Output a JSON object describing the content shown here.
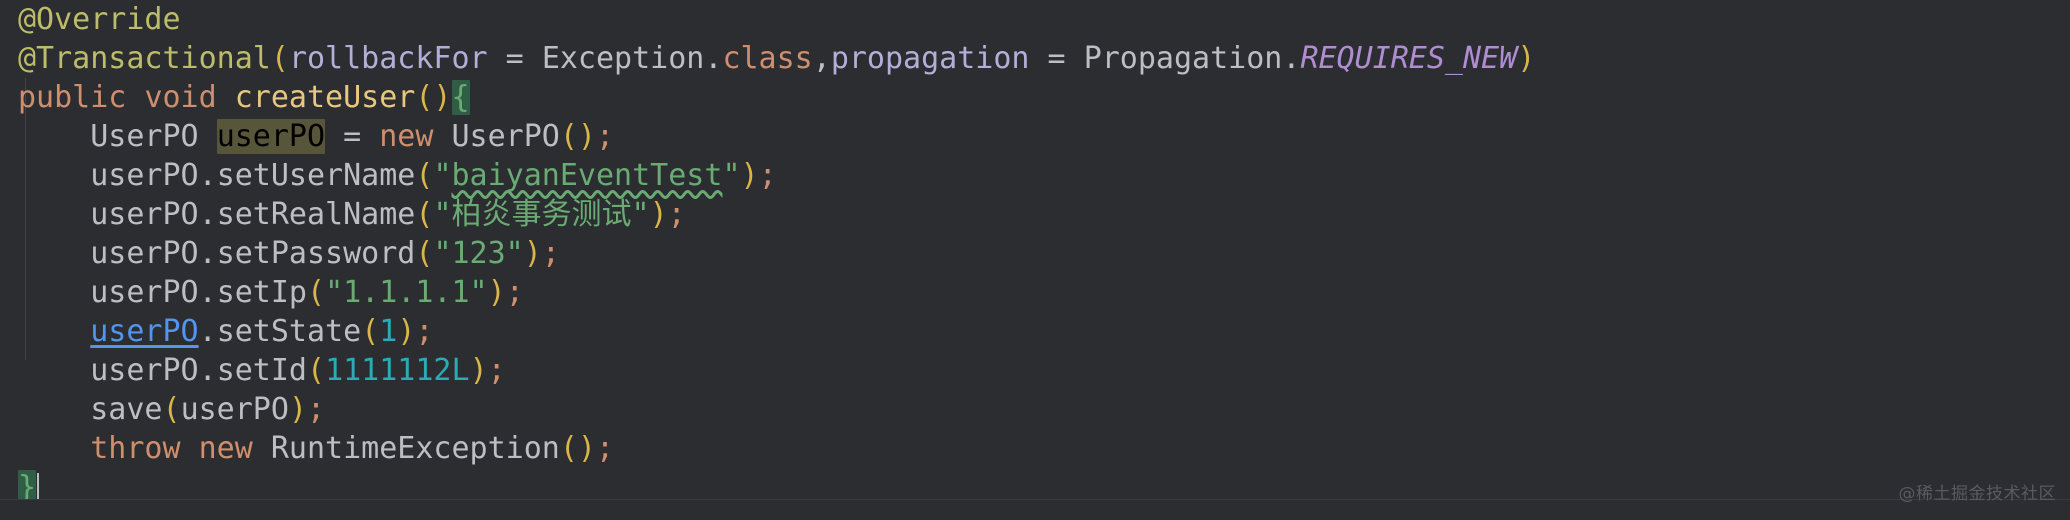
{
  "editor": {
    "language": "java",
    "background_color": "#2b2d30",
    "watermark": "@稀土掘金技术社区",
    "lines": [
      {
        "index": 1,
        "text": "@Override",
        "tokens": [
          {
            "t": "@Override",
            "c": "annotation"
          }
        ]
      },
      {
        "index": 2,
        "text": "@Transactional(rollbackFor = Exception.class,propagation = Propagation.REQUIRES_NEW)",
        "tokens": [
          {
            "t": "@Transactional",
            "c": "annotation"
          },
          {
            "t": "(",
            "c": "paren"
          },
          {
            "t": "rollbackFor",
            "c": "named-arg"
          },
          {
            "t": " = ",
            "c": "punct"
          },
          {
            "t": "Exception",
            "c": "classref"
          },
          {
            "t": ".",
            "c": "dot"
          },
          {
            "t": "class",
            "c": "keyword"
          },
          {
            "t": ",",
            "c": "punct"
          },
          {
            "t": "propagation",
            "c": "named-arg"
          },
          {
            "t": " = ",
            "c": "punct"
          },
          {
            "t": "Propagation",
            "c": "classref"
          },
          {
            "t": ".",
            "c": "dot"
          },
          {
            "t": "REQUIRES_NEW",
            "c": "static-field"
          },
          {
            "t": ")",
            "c": "paren"
          }
        ]
      },
      {
        "index": 3,
        "text": "public void createUser(){",
        "tokens": [
          {
            "t": "public",
            "c": "keyword"
          },
          {
            "t": " ",
            "c": "punct"
          },
          {
            "t": "void",
            "c": "keyword"
          },
          {
            "t": " ",
            "c": "punct"
          },
          {
            "t": "createUser",
            "c": "method-decl"
          },
          {
            "t": "()",
            "c": "paren"
          },
          {
            "t": "{",
            "c": "hl-brace"
          }
        ]
      },
      {
        "index": 4,
        "text": "    UserPO userPO = new UserPO();",
        "tokens": [
          {
            "t": "    ",
            "c": "punct"
          },
          {
            "t": "UserPO",
            "c": "classref"
          },
          {
            "t": " ",
            "c": "punct"
          },
          {
            "t": "userPO",
            "c": "hl-ident"
          },
          {
            "t": " = ",
            "c": "punct"
          },
          {
            "t": "new",
            "c": "keyword"
          },
          {
            "t": " ",
            "c": "punct"
          },
          {
            "t": "UserPO",
            "c": "classref"
          },
          {
            "t": "()",
            "c": "paren"
          },
          {
            "t": ";",
            "c": "semi"
          }
        ]
      },
      {
        "index": 5,
        "text": "    userPO.setUserName(\"baiyanEventTest\");",
        "tokens": [
          {
            "t": "    ",
            "c": "punct"
          },
          {
            "t": "userPO",
            "c": "ident"
          },
          {
            "t": ".",
            "c": "dot"
          },
          {
            "t": "setUserName",
            "c": "ident"
          },
          {
            "t": "(",
            "c": "paren"
          },
          {
            "t": "\"",
            "c": "string"
          },
          {
            "t": "baiyanEventTest",
            "c": "string squiggle"
          },
          {
            "t": "\"",
            "c": "string"
          },
          {
            "t": ")",
            "c": "paren"
          },
          {
            "t": ";",
            "c": "semi"
          }
        ]
      },
      {
        "index": 6,
        "text": "    userPO.setRealName(\"柏炎事务测试\");",
        "tokens": [
          {
            "t": "    ",
            "c": "punct"
          },
          {
            "t": "userPO",
            "c": "ident"
          },
          {
            "t": ".",
            "c": "dot"
          },
          {
            "t": "setRealName",
            "c": "ident"
          },
          {
            "t": "(",
            "c": "paren"
          },
          {
            "t": "\"",
            "c": "string"
          },
          {
            "t": "柏炎事务测试",
            "c": "string cn"
          },
          {
            "t": "\"",
            "c": "string"
          },
          {
            "t": ")",
            "c": "paren"
          },
          {
            "t": ";",
            "c": "semi"
          }
        ]
      },
      {
        "index": 7,
        "text": "    userPO.setPassword(\"123\");",
        "tokens": [
          {
            "t": "    ",
            "c": "punct"
          },
          {
            "t": "userPO",
            "c": "ident"
          },
          {
            "t": ".",
            "c": "dot"
          },
          {
            "t": "setPassword",
            "c": "ident"
          },
          {
            "t": "(",
            "c": "paren"
          },
          {
            "t": "\"123\"",
            "c": "string"
          },
          {
            "t": ")",
            "c": "paren"
          },
          {
            "t": ";",
            "c": "semi"
          }
        ]
      },
      {
        "index": 8,
        "text": "    userPO.setIp(\"1.1.1.1\");",
        "tokens": [
          {
            "t": "    ",
            "c": "punct"
          },
          {
            "t": "userPO",
            "c": "ident"
          },
          {
            "t": ".",
            "c": "dot"
          },
          {
            "t": "setIp",
            "c": "ident"
          },
          {
            "t": "(",
            "c": "paren"
          },
          {
            "t": "\"1.1.1.1\"",
            "c": "string"
          },
          {
            "t": ")",
            "c": "paren"
          },
          {
            "t": ";",
            "c": "semi"
          }
        ]
      },
      {
        "index": 9,
        "text": "    userPO.setState(1);",
        "tokens": [
          {
            "t": "    ",
            "c": "punct"
          },
          {
            "t": "userPO",
            "c": "link-ident"
          },
          {
            "t": ".",
            "c": "dot"
          },
          {
            "t": "setState",
            "c": "ident"
          },
          {
            "t": "(",
            "c": "paren"
          },
          {
            "t": "1",
            "c": "number"
          },
          {
            "t": ")",
            "c": "paren"
          },
          {
            "t": ";",
            "c": "semi"
          }
        ]
      },
      {
        "index": 10,
        "text": "    userPO.setId(1111112L);",
        "tokens": [
          {
            "t": "    ",
            "c": "punct"
          },
          {
            "t": "userPO",
            "c": "ident"
          },
          {
            "t": ".",
            "c": "dot"
          },
          {
            "t": "setId",
            "c": "ident"
          },
          {
            "t": "(",
            "c": "paren"
          },
          {
            "t": "1111112L",
            "c": "number"
          },
          {
            "t": ")",
            "c": "paren"
          },
          {
            "t": ";",
            "c": "semi"
          }
        ]
      },
      {
        "index": 11,
        "text": "    save(userPO);",
        "tokens": [
          {
            "t": "    ",
            "c": "punct"
          },
          {
            "t": "save",
            "c": "ident"
          },
          {
            "t": "(",
            "c": "paren"
          },
          {
            "t": "userPO",
            "c": "ident"
          },
          {
            "t": ")",
            "c": "paren"
          },
          {
            "t": ";",
            "c": "semi"
          }
        ]
      },
      {
        "index": 12,
        "text": "    throw new RuntimeException();",
        "tokens": [
          {
            "t": "    ",
            "c": "punct"
          },
          {
            "t": "throw",
            "c": "keyword"
          },
          {
            "t": " ",
            "c": "punct"
          },
          {
            "t": "new",
            "c": "keyword"
          },
          {
            "t": " ",
            "c": "punct"
          },
          {
            "t": "RuntimeException",
            "c": "classref"
          },
          {
            "t": "()",
            "c": "paren"
          },
          {
            "t": ";",
            "c": "semi"
          }
        ]
      },
      {
        "index": 13,
        "text": "}",
        "caret_after": true,
        "tokens": [
          {
            "t": "}",
            "c": "hl-brace"
          }
        ]
      }
    ]
  }
}
